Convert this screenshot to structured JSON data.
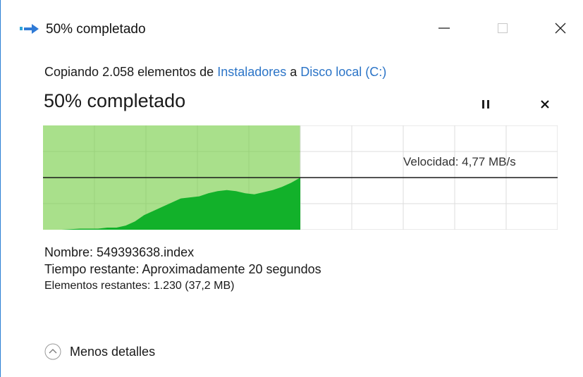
{
  "window": {
    "title": "50% completado",
    "buttons": {
      "minimize": "—",
      "maximize": "☐",
      "close": "✕"
    }
  },
  "copy": {
    "prefix": "Copiando 2.058 elementos de ",
    "source": "Instaladores",
    "middle": " a ",
    "destination": "Disco local (C:)"
  },
  "progress": {
    "title": "50% completado",
    "percent": 50,
    "speed_label": "Velocidad: 4,77 MB/s"
  },
  "chart_data": {
    "type": "area",
    "series": [
      {
        "values": [
          0,
          0,
          0,
          0.5,
          1,
          1,
          1,
          2,
          2,
          4,
          8,
          14,
          18,
          22,
          26,
          30,
          31,
          32,
          35,
          37,
          38,
          37,
          35,
          34,
          36,
          38,
          41,
          45,
          50
        ]
      }
    ],
    "progress_fraction": 0.5,
    "speed_line_fraction": 0.5
  },
  "details": {
    "name_label": "Nombre:",
    "name_value": "549393638.index",
    "time_label": "Tiempo restante:",
    "time_value": "Aproximadamente 20 segundos",
    "items_label": "Elementos restantes:",
    "items_value": "1.230 (37,2 MB)"
  },
  "footer": {
    "less_details": "Menos detalles"
  },
  "colors": {
    "accent": "#2b74c7",
    "progress_fill": "#a9e08b",
    "graph_fill": "#12b12a",
    "grid": "#9bd27c"
  }
}
